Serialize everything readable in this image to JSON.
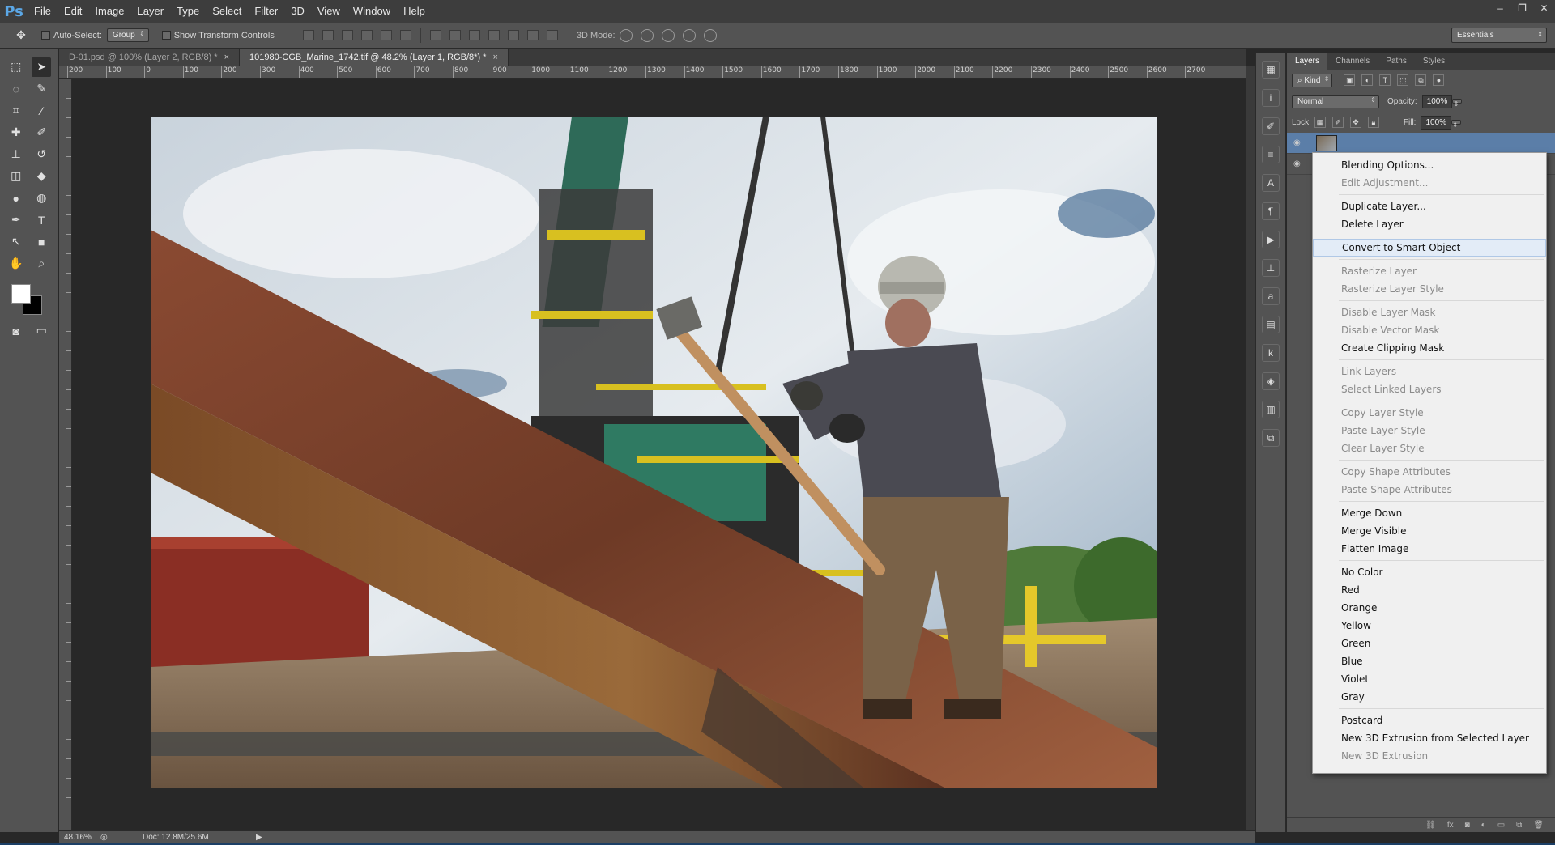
{
  "app": {
    "logo": "Ps"
  },
  "menu": [
    "File",
    "Edit",
    "Image",
    "Layer",
    "Type",
    "Select",
    "Filter",
    "3D",
    "View",
    "Window",
    "Help"
  ],
  "window_controls": {
    "minimize": "–",
    "restore": "❐",
    "close": "✕"
  },
  "options": {
    "auto_select_label": "Auto-Select:",
    "auto_select_value": "Group",
    "transform_label": "Show Transform Controls",
    "mode3d_label": "3D Mode:",
    "workspace": "Essentials"
  },
  "tabs": [
    {
      "label": "D-01.psd @ 100% (Layer 2, RGB/8) *",
      "active": false
    },
    {
      "label": "101980-CGB_Marine_1742.tif @ 48.2% (Layer 1, RGB/8*) *",
      "active": true
    }
  ],
  "ruler_h": [
    "200",
    "100",
    "0",
    "100",
    "200",
    "300",
    "400",
    "500",
    "600",
    "700",
    "800",
    "900",
    "1000",
    "1100",
    "1200",
    "1300",
    "1400",
    "1500",
    "1600",
    "1700",
    "1800",
    "1900",
    "2000",
    "2100",
    "2200",
    "2300",
    "2400",
    "2500",
    "2600",
    "2700"
  ],
  "status": {
    "zoom": "48.16%",
    "doc": "Doc: 12.8M/25.6M"
  },
  "panel": {
    "tabs": [
      "Layers",
      "Channels",
      "Paths",
      "Styles"
    ],
    "kind_label": "Kind",
    "blend_mode": "Normal",
    "opacity_label": "Opacity:",
    "opacity_value": "100%",
    "lock_label": "Lock:",
    "fill_label": "Fill:",
    "fill_value": "100%"
  },
  "context_menu": [
    {
      "label": "Blending Options...",
      "state": "normal"
    },
    {
      "label": "Edit Adjustment...",
      "state": "disabled"
    },
    {
      "sep": true
    },
    {
      "label": "Duplicate Layer...",
      "state": "normal"
    },
    {
      "label": "Delete Layer",
      "state": "normal"
    },
    {
      "sep": true
    },
    {
      "label": "Convert to Smart Object",
      "state": "hover"
    },
    {
      "sep": true
    },
    {
      "label": "Rasterize Layer",
      "state": "disabled"
    },
    {
      "label": "Rasterize Layer Style",
      "state": "disabled"
    },
    {
      "sep": true
    },
    {
      "label": "Disable Layer Mask",
      "state": "disabled"
    },
    {
      "label": "Disable Vector Mask",
      "state": "disabled"
    },
    {
      "label": "Create Clipping Mask",
      "state": "normal"
    },
    {
      "sep": true
    },
    {
      "label": "Link Layers",
      "state": "disabled"
    },
    {
      "label": "Select Linked Layers",
      "state": "disabled"
    },
    {
      "sep": true
    },
    {
      "label": "Copy Layer Style",
      "state": "disabled"
    },
    {
      "label": "Paste Layer Style",
      "state": "disabled"
    },
    {
      "label": "Clear Layer Style",
      "state": "disabled"
    },
    {
      "sep": true
    },
    {
      "label": "Copy Shape Attributes",
      "state": "disabled"
    },
    {
      "label": "Paste Shape Attributes",
      "state": "disabled"
    },
    {
      "sep": true
    },
    {
      "label": "Merge Down",
      "state": "normal"
    },
    {
      "label": "Merge Visible",
      "state": "normal"
    },
    {
      "label": "Flatten Image",
      "state": "normal"
    },
    {
      "sep": true
    },
    {
      "label": "No Color",
      "state": "normal"
    },
    {
      "label": "Red",
      "state": "normal"
    },
    {
      "label": "Orange",
      "state": "normal"
    },
    {
      "label": "Yellow",
      "state": "normal"
    },
    {
      "label": "Green",
      "state": "normal"
    },
    {
      "label": "Blue",
      "state": "normal"
    },
    {
      "label": "Violet",
      "state": "normal"
    },
    {
      "label": "Gray",
      "state": "normal"
    },
    {
      "sep": true
    },
    {
      "label": "Postcard",
      "state": "normal"
    },
    {
      "label": "New 3D Extrusion from Selected Layer",
      "state": "normal"
    },
    {
      "label": "New 3D Extrusion",
      "state": "disabled"
    }
  ],
  "colors": {
    "accent": "#5ba7e6",
    "selection": "#5b7ea8"
  }
}
